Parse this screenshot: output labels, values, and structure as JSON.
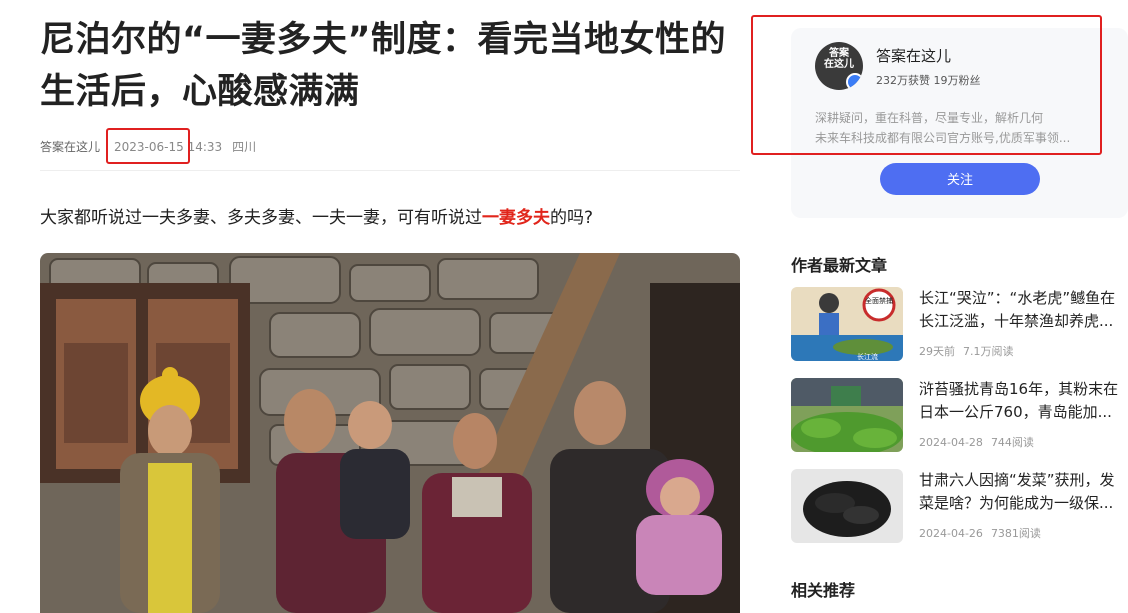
{
  "article": {
    "title": "尼泊尔的“一妻多夫”制度：看完当地女性的生活后，心酸感满满",
    "author": "答案在这儿",
    "date": "2023-06-15 14:33",
    "location": "四川",
    "intro_before": "大家都听说过一夫多妻、多夫多妻、一夫一妻，可有听说过",
    "intro_highlight": "一妻多夫",
    "intro_after": "的吗?"
  },
  "author_card": {
    "avatar_text": "答案\n在这儿",
    "name": "答案在这儿",
    "stats": "232万获赞 19万粉丝",
    "desc_line1": "深耕疑问，重在科普，尽量专业，解析几何",
    "desc_line2": "未来车科技成都有限公司官方账号,优质军事领...",
    "follow_label": "关注"
  },
  "latest": {
    "heading": "作者最新文章",
    "items": [
      {
        "title": "长江“哭泣”：“水老虎”鳡鱼在长江泛滥，十年禁渔却养虎...",
        "date": "29天前",
        "reads": "7.1万阅读",
        "thumb_label": "长江流",
        "thumb_badge": "全面禁捕"
      },
      {
        "title": "浒苔骚扰青岛16年，其粉末在日本一公斤760，青岛能加...",
        "date": "2024-04-28",
        "reads": "744阅读"
      },
      {
        "title": "甘肃六人因摘“发菜”获刑，发菜是啥？为何能成为一级保...",
        "date": "2024-04-26",
        "reads": "7381阅读"
      }
    ]
  },
  "related": {
    "heading": "相关推荐"
  },
  "colors": {
    "accent": "#4e6ef2",
    "highlight": "#e1251b",
    "annotation": "#e02020"
  }
}
